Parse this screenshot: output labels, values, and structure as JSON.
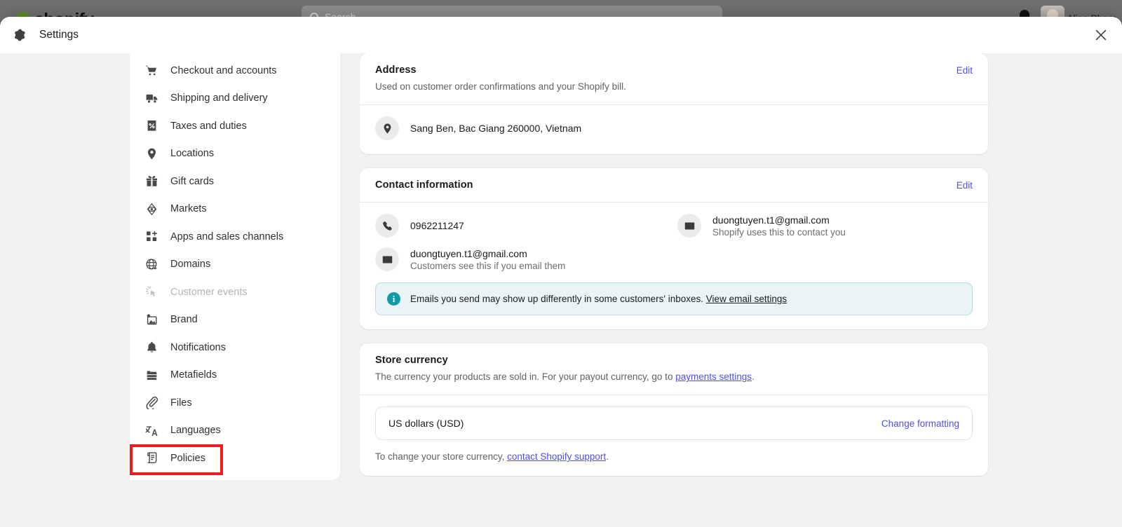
{
  "background": {
    "brand": "shopify",
    "search_placeholder": "Search",
    "user_name": "Alice Phạm",
    "bell_icon": "notification-bell-icon",
    "search_icon": "search-icon"
  },
  "modal": {
    "title": "Settings",
    "gear_icon": "gear-icon",
    "close_icon": "close-icon"
  },
  "sidebar": {
    "items": [
      {
        "label": "Checkout and accounts",
        "icon": "shopping-cart-icon",
        "disabled": false,
        "highlighted": false
      },
      {
        "label": "Shipping and delivery",
        "icon": "delivery-truck-icon",
        "disabled": false,
        "highlighted": false
      },
      {
        "label": "Taxes and duties",
        "icon": "tax-receipt-icon",
        "disabled": false,
        "highlighted": false
      },
      {
        "label": "Locations",
        "icon": "location-pin-icon",
        "disabled": false,
        "highlighted": false
      },
      {
        "label": "Gift cards",
        "icon": "gift-card-icon",
        "disabled": false,
        "highlighted": false
      },
      {
        "label": "Markets",
        "icon": "globe-target-icon",
        "disabled": false,
        "highlighted": false
      },
      {
        "label": "Apps and sales channels",
        "icon": "apps-grid-plus-icon",
        "disabled": false,
        "highlighted": false
      },
      {
        "label": "Domains",
        "icon": "globe-icon",
        "disabled": false,
        "highlighted": false
      },
      {
        "label": "Customer events",
        "icon": "click-sparkle-icon",
        "disabled": true,
        "highlighted": false
      },
      {
        "label": "Brand",
        "icon": "image-brand-icon",
        "disabled": false,
        "highlighted": false
      },
      {
        "label": "Notifications",
        "icon": "bell-icon",
        "disabled": false,
        "highlighted": false
      },
      {
        "label": "Metafields",
        "icon": "metafields-icon",
        "disabled": false,
        "highlighted": false
      },
      {
        "label": "Files",
        "icon": "paperclip-icon",
        "disabled": false,
        "highlighted": false
      },
      {
        "label": "Languages",
        "icon": "translate-icon",
        "disabled": false,
        "highlighted": false
      },
      {
        "label": "Policies",
        "icon": "scroll-document-icon",
        "disabled": false,
        "highlighted": true
      }
    ]
  },
  "content": {
    "address_card": {
      "title": "Address",
      "subtitle": "Used on customer order confirmations and your Shopify bill.",
      "edit_label": "Edit",
      "address_icon": "location-pin-icon",
      "address_value": "Sang Ben, Bac Giang 260000, Vietnam"
    },
    "contact_card": {
      "title": "Contact information",
      "edit_label": "Edit",
      "entries": [
        {
          "icon": "phone-icon",
          "primary": "0962211247",
          "secondary": ""
        },
        {
          "icon": "envelope-icon",
          "primary": "duongtuyen.t1@gmail.com",
          "secondary": "Shopify uses this to contact you"
        },
        {
          "icon": "envelope-icon",
          "primary": "duongtuyen.t1@gmail.com",
          "secondary": "Customers see this if you email them"
        }
      ],
      "banner": {
        "icon": "info-icon",
        "text": "Emails you send may show up differently in some customers' inboxes.",
        "link": "View email settings"
      }
    },
    "currency_card": {
      "title": "Store currency",
      "subtitle_before": "The currency your products are sold in. For your payout currency, go to ",
      "subtitle_link": "payments settings",
      "subtitle_after": ".",
      "currency_value": "US dollars (USD)",
      "change_formatting_label": "Change formatting",
      "note_before": "To change your store currency, ",
      "note_link": "contact Shopify support",
      "note_after": "."
    }
  },
  "colors": {
    "accent_link": "#4f4fe3",
    "highlight_box": "#ee1c1c",
    "info_banner_bg": "#e8f4f6",
    "info_icon": "#0f9aa8",
    "brand_green": "#5a8f2a"
  }
}
